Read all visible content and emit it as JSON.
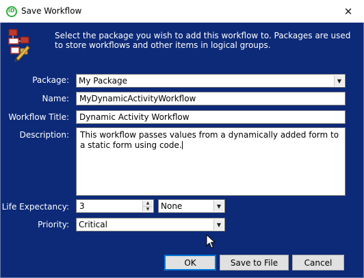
{
  "window": {
    "title": "Save Workflow",
    "close_symbol": "✕",
    "icon": "app-logo-icon"
  },
  "header": {
    "icon": "workflow-icon",
    "intro_text": "Select the package you wish to add this workflow to. Packages are used to store workflows and other items in logical groups."
  },
  "form": {
    "package_label": "Package:",
    "package_value": "My Package",
    "name_label": "Name:",
    "name_value": "MyDynamicActivityWorkflow",
    "workflow_title_label": "Workflow Title:",
    "workflow_title_value": "Dynamic Activity Workflow",
    "description_label": "Description:",
    "description_value": "This workflow passes values from a dynamically added form to a static form using code.",
    "life_expectancy_label": "Life Expectancy:",
    "life_expectancy_value": "3",
    "life_expectancy_unit": "None",
    "priority_label": "Priority:",
    "priority_value": "Critical"
  },
  "buttons": {
    "ok": "OK",
    "save_to_file": "Save to File",
    "cancel": "Cancel"
  },
  "colors": {
    "dialog_background": "#0d2a78",
    "default_button_border": "#0078d7"
  }
}
